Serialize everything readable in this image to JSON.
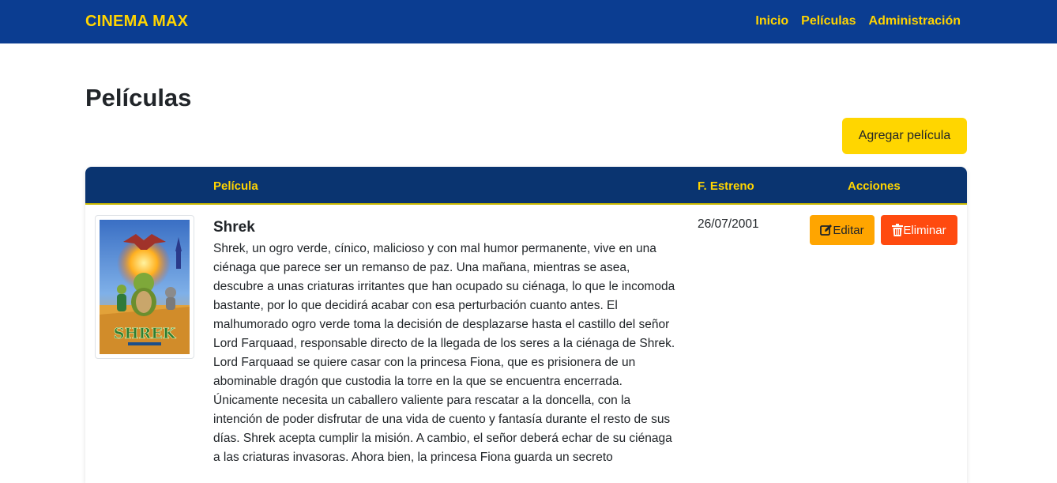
{
  "navbar": {
    "brand": "CINEMA MAX",
    "links": [
      "Inicio",
      "Películas",
      "Administración"
    ]
  },
  "page": {
    "title": "Películas",
    "add_button": "Agregar película"
  },
  "table": {
    "headers": {
      "movie": "Película",
      "release": "F. Estreno",
      "actions": "Acciones"
    },
    "rows": [
      {
        "title": "Shrek",
        "description": "Shrek, un ogro verde, cínico, malicioso y con mal humor permanente, vive en una ciénaga que parece ser un remanso de paz. Una mañana, mientras se asea, descubre a unas criaturas irritantes que han ocupado su ciénaga, lo que le incomoda bastante, por lo que decidirá acabar con esa perturbación cuanto antes. El malhumorado ogro verde toma la decisión de desplazarse hasta el castillo del señor Lord Farquaad, responsable directo de la llegada de los seres a la ciénaga de Shrek. Lord Farquaad se quiere casar con la princesa Fiona, que es prisionera de un abominable dragón que custodia la torre en la que se encuentra encerrada. Únicamente necesita un caballero valiente para rescatar a la doncella, con la intención de poder disfrutar de una vida de cuento y fantasía durante el resto de sus días. Shrek acepta cumplir la misión. A cambio, el señor deberá echar de su ciénaga a las criaturas invasoras. Ahora bien, la princesa Fiona guarda un secreto",
        "release_date": "26/07/2001",
        "poster_text": "SHREK",
        "edit_label": "Editar",
        "delete_label": "Eliminar"
      }
    ]
  },
  "colors": {
    "navbar": "#0b3d91",
    "accent": "#ffd400",
    "table_header": "#0a3470",
    "edit": "#ffa500",
    "delete": "#ff4a0f"
  },
  "icons": {
    "edit": "pencil-square-icon",
    "delete": "trash-icon"
  }
}
